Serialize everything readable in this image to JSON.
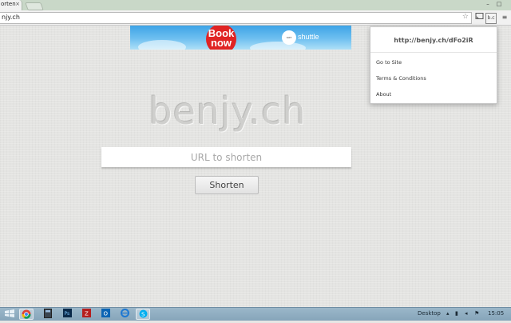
{
  "browser": {
    "tab_title": "orten",
    "tab_close": "×",
    "address": "njy.ch",
    "window_controls": [
      "–",
      "□"
    ],
    "toolbar_icons": [
      "star-icon",
      "cast-icon",
      "extension-icon",
      "menu-icon"
    ]
  },
  "ad": {
    "cta": "Book now",
    "badge": "SIXT SHUTTLE",
    "brand": "shuttle"
  },
  "page": {
    "logo": "benjy.ch",
    "url_placeholder": "URL to shorten",
    "shorten_label": "Shorten"
  },
  "popup": {
    "short_url": "http://benjy.ch/dFo2iR",
    "items": [
      "Go to Site",
      "Terms & Conditions",
      "About"
    ]
  },
  "taskbar": {
    "apps": [
      "start",
      "chrome",
      "calculator",
      "photoshop",
      "filezilla",
      "outlook",
      "ie",
      "skype"
    ],
    "desktop_label": "Desktop",
    "clock": "15:05"
  },
  "colors": {
    "ad_cta": "#e02424",
    "taskbar": "#8eaec2",
    "tab_strip": "#c9d8c8"
  }
}
